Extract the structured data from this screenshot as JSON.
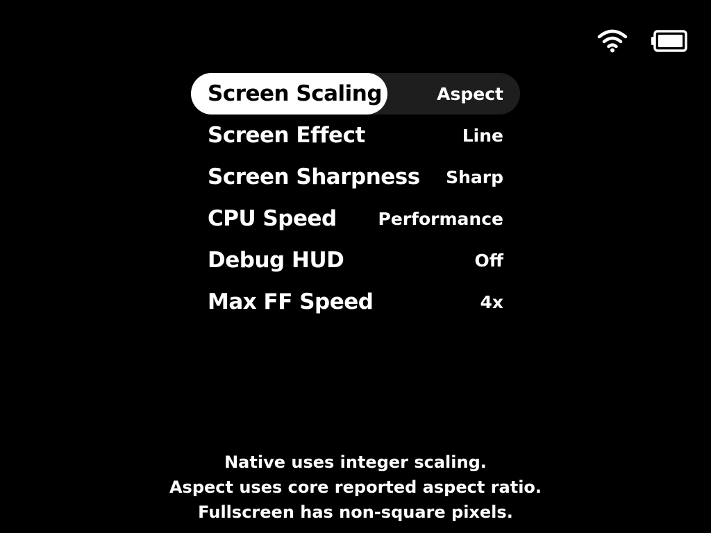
{
  "status": {
    "wifi_icon": "wifi-icon",
    "battery_icon": "battery-icon"
  },
  "menu": {
    "items": [
      {
        "label": "Screen Scaling",
        "value": "Aspect",
        "selected": true
      },
      {
        "label": "Screen Effect",
        "value": "Line"
      },
      {
        "label": "Screen Sharpness",
        "value": "Sharp"
      },
      {
        "label": "CPU Speed",
        "value": "Performance"
      },
      {
        "label": "Debug HUD",
        "value": "Off"
      },
      {
        "label": "Max FF Speed",
        "value": "4x"
      }
    ]
  },
  "description": {
    "lines": [
      "Native uses integer scaling.",
      "Aspect uses core reported aspect ratio.",
      "Fullscreen has non-square pixels."
    ]
  },
  "colors": {
    "background": "#000000",
    "text": "#ffffff",
    "selected_pill": "#ffffff",
    "selected_row": "#1e1e1e"
  }
}
